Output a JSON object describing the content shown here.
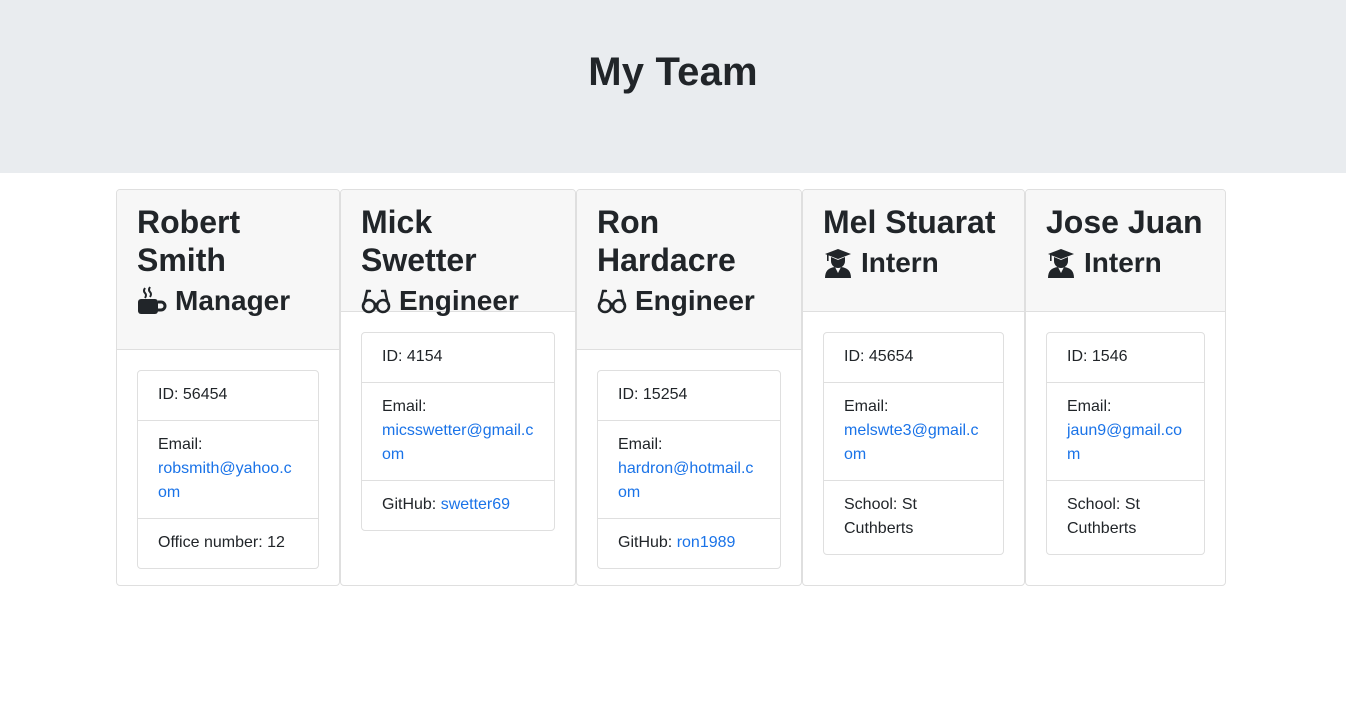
{
  "header": {
    "title": "My Team"
  },
  "cards": [
    {
      "name": "Robert Smith",
      "role": "Manager",
      "role_icon": "coffee-mug-icon",
      "id_label": "ID: 56454",
      "email_label": "Email:",
      "email": "robsmith@yahoo.com",
      "extra_label": "Office number: 12",
      "extra_value": ""
    },
    {
      "name": "Mick Swetter",
      "role": "Engineer",
      "role_icon": "glasses-icon",
      "id_label": "ID: 4154",
      "email_label": "Email:",
      "email": "micsswetter@gmail.com",
      "extra_label": "GitHub: ",
      "extra_value": "swetter69"
    },
    {
      "name": "Ron Hardacre",
      "role": "Engineer",
      "role_icon": "glasses-icon",
      "id_label": "ID: 15254",
      "email_label": "Email:",
      "email": "hardron@hotmail.com",
      "extra_label": "GitHub: ",
      "extra_value": "ron1989"
    },
    {
      "name": "Mel Stuarat",
      "role": "Intern",
      "role_icon": "graduate-icon",
      "id_label": "ID: 45654",
      "email_label": "Email:",
      "email": "melswte3@gmail.com",
      "extra_label": "School: St Cuthberts",
      "extra_value": ""
    },
    {
      "name": "Jose Juan",
      "role": "Intern",
      "role_icon": "graduate-icon",
      "id_label": "ID: 1546",
      "email_label": "Email:",
      "email": "jaun9@gmail.com",
      "extra_label": "School: St Cuthberts",
      "extra_value": ""
    }
  ],
  "colors": {
    "jumbotron": "#e9ecef",
    "link": "#1a73e8",
    "header_bg": "#f7f7f7"
  }
}
